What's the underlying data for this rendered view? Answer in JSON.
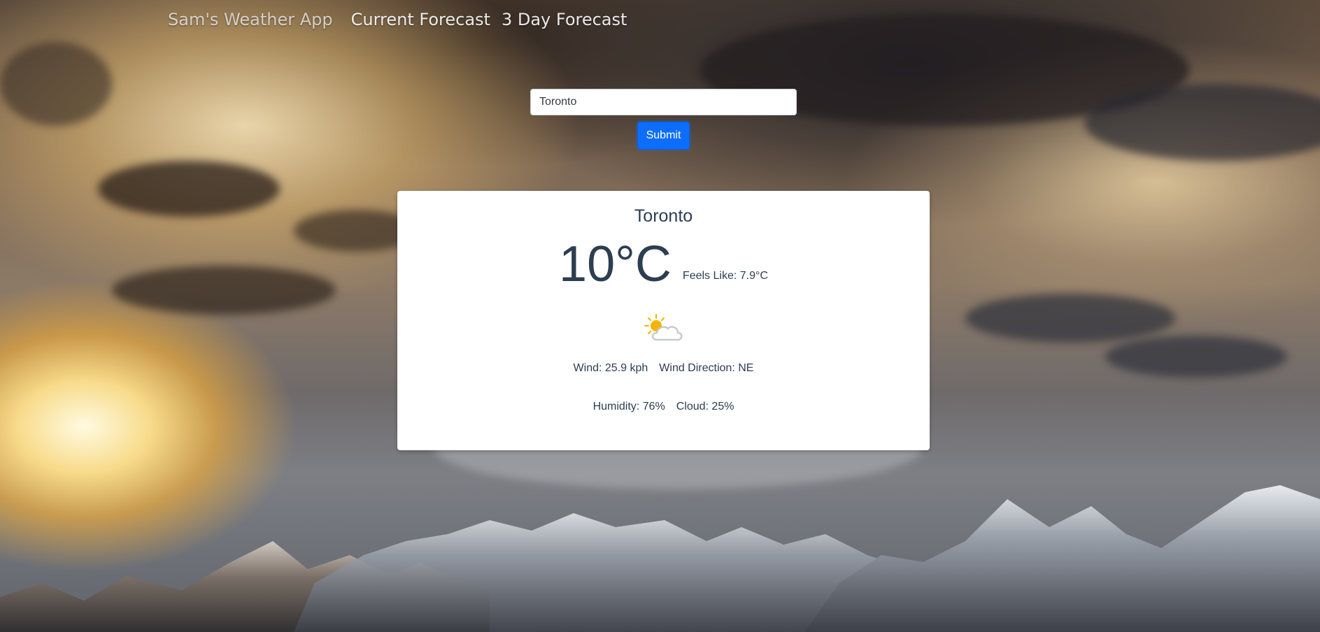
{
  "nav": {
    "brand": "Sam's Weather App",
    "links": [
      "Current Forecast",
      "3 Day Forecast"
    ]
  },
  "search": {
    "value": "Toronto",
    "submit_label": "Submit"
  },
  "weather": {
    "city": "Toronto",
    "temperature": "10°C",
    "feels_like": "Feels Like: 7.9°C",
    "condition_icon": "partly-cloudy-icon",
    "wind": "Wind: 25.9 kph",
    "wind_direction": "Wind Direction: NE",
    "humidity": "Humidity: 76%",
    "cloud": "Cloud: 25%"
  },
  "colors": {
    "accent": "#0d6efd",
    "card_text": "#2c3e50",
    "sun": "#f5b400"
  }
}
